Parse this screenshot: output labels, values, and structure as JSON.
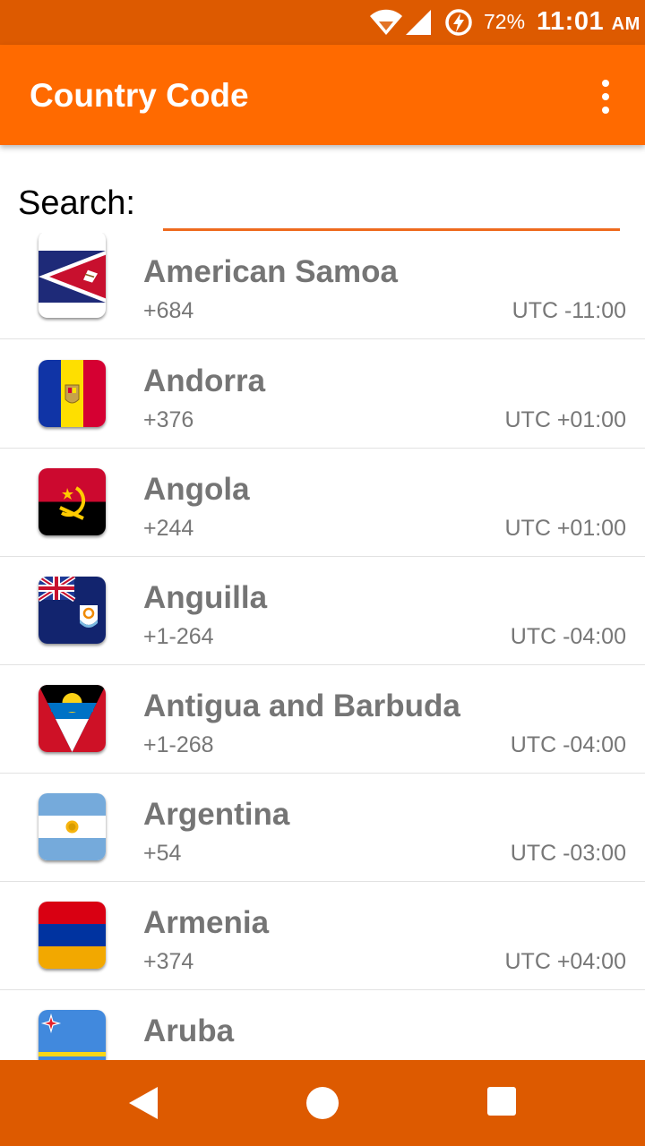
{
  "status_bar": {
    "battery": "72%",
    "time": "11:01",
    "ampm": "AM",
    "icons": [
      "wifi-icon",
      "signal-icon",
      "battery-charging-icon"
    ]
  },
  "app_bar": {
    "title": "Country Code",
    "menu_icon": "overflow-menu-icon"
  },
  "search": {
    "label": "Search:",
    "value": "",
    "placeholder": ""
  },
  "countries": [
    {
      "name": "American Samoa",
      "code": "+684",
      "utc": "UTC -11:00",
      "flag": "american-samoa-flag"
    },
    {
      "name": "Andorra",
      "code": "+376",
      "utc": "UTC +01:00",
      "flag": "andorra-flag"
    },
    {
      "name": "Angola",
      "code": "+244",
      "utc": "UTC +01:00",
      "flag": "angola-flag"
    },
    {
      "name": "Anguilla",
      "code": "+1-264",
      "utc": "UTC -04:00",
      "flag": "anguilla-flag"
    },
    {
      "name": "Antigua and Barbuda",
      "code": "+1-268",
      "utc": "UTC -04:00",
      "flag": "antigua-barbuda-flag"
    },
    {
      "name": "Argentina",
      "code": "+54",
      "utc": "UTC -03:00",
      "flag": "argentina-flag"
    },
    {
      "name": "Armenia",
      "code": "+374",
      "utc": "UTC +04:00",
      "flag": "armenia-flag"
    },
    {
      "name": "Aruba",
      "code": "",
      "utc": "",
      "flag": "aruba-flag"
    }
  ],
  "colors": {
    "status_bar": "#dd5a00",
    "app_bar": "#ff6a00",
    "accent_underline": "#ee6a1e",
    "name_text": "#757575",
    "nav_bar": "#dd5a00"
  },
  "nav_bar": {
    "icons": [
      "back-icon",
      "home-icon",
      "recents-icon"
    ]
  }
}
